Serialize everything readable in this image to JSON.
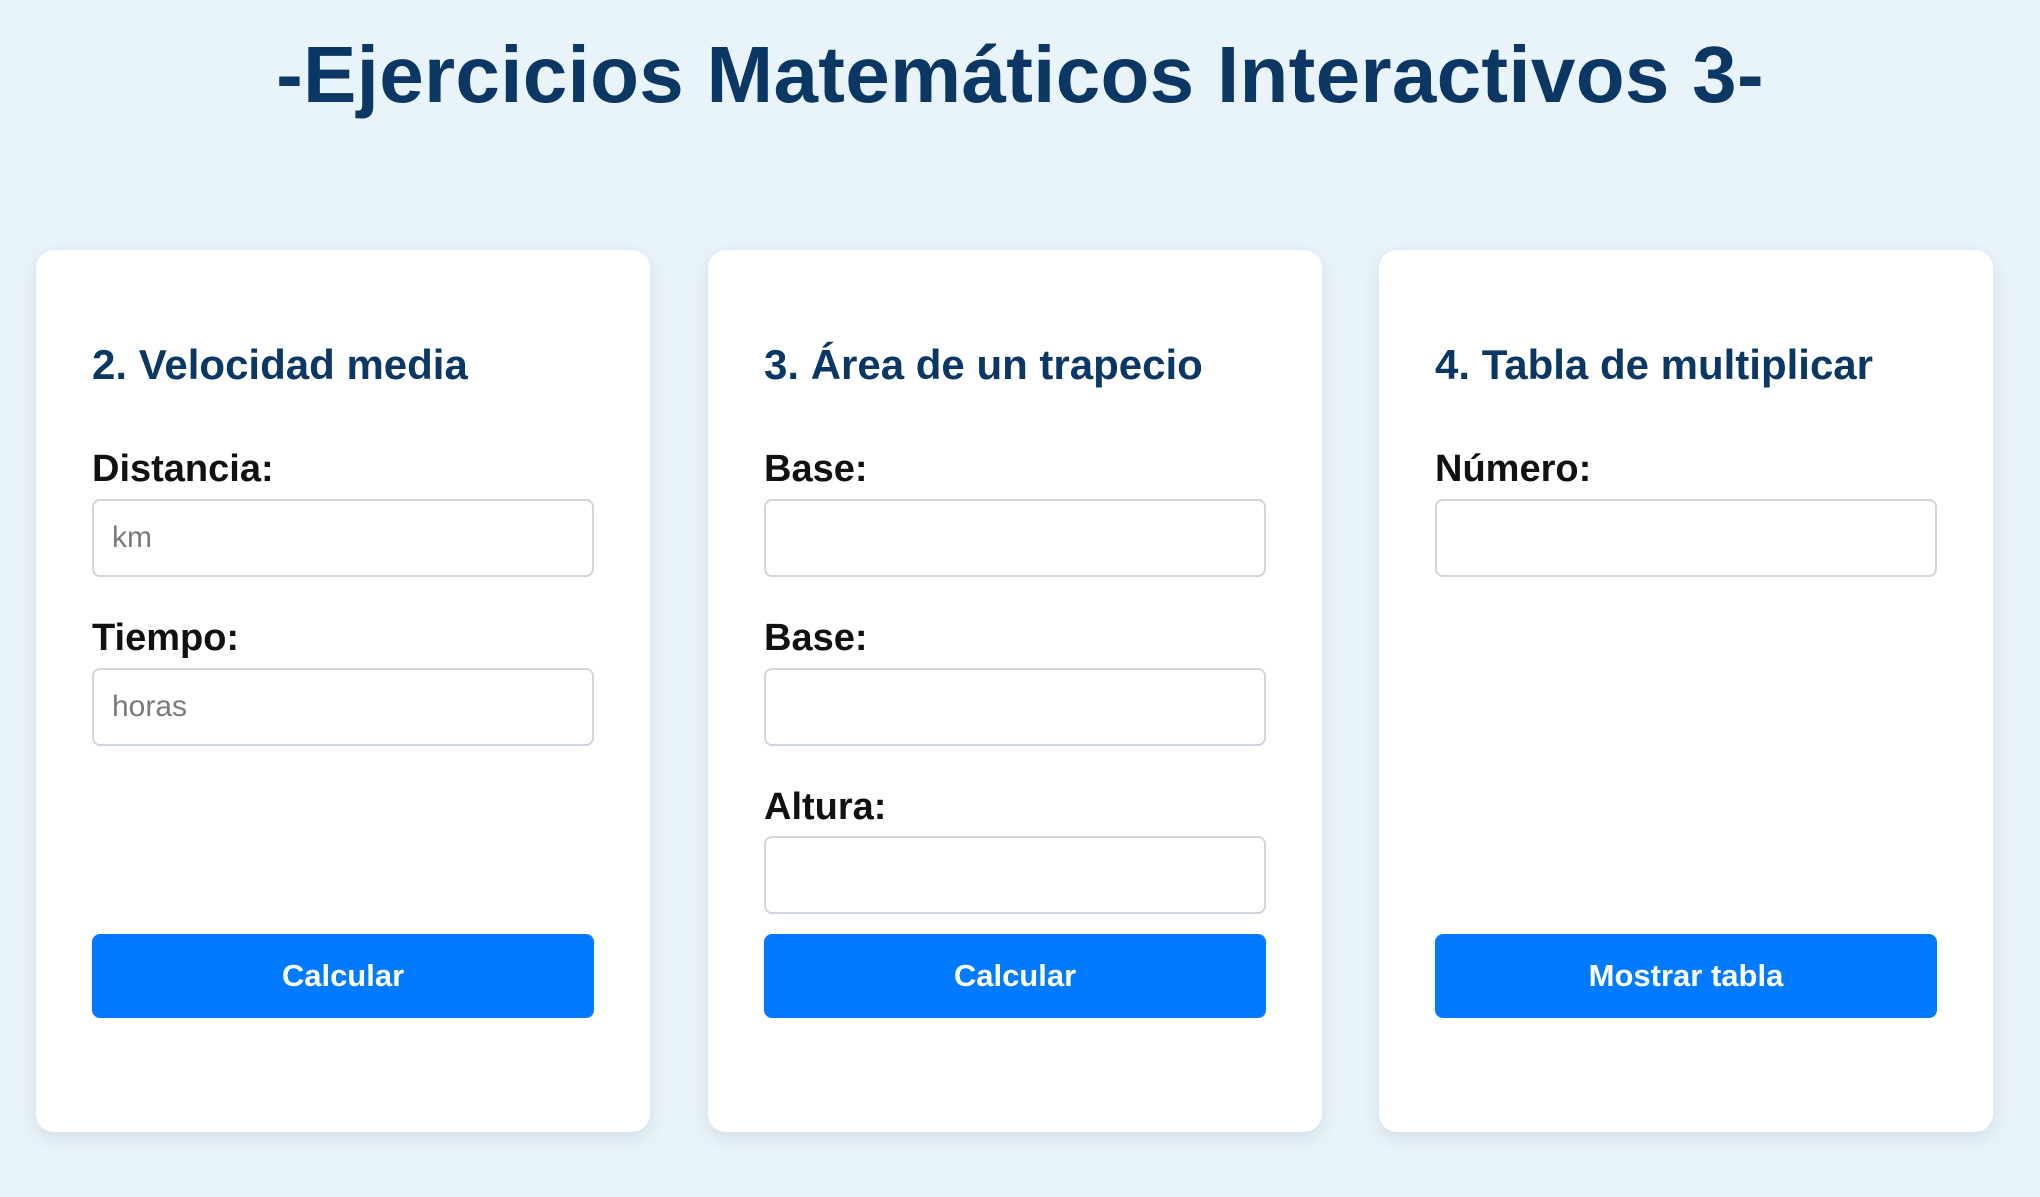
{
  "page": {
    "title": "-Ejercicios Matemáticos Interactivos 3-"
  },
  "cards": [
    {
      "title": "2. Velocidad media",
      "fields": [
        {
          "label": "Distancia:",
          "value": "",
          "placeholder": "km"
        },
        {
          "label": "Tiempo:",
          "value": "",
          "placeholder": "horas"
        }
      ],
      "button_label": "Calcular"
    },
    {
      "title": "3. Área de un trapecio",
      "fields": [
        {
          "label": "Base:",
          "value": "",
          "placeholder": ""
        },
        {
          "label": "Base:",
          "value": "",
          "placeholder": ""
        },
        {
          "label": "Altura:",
          "value": "",
          "placeholder": ""
        }
      ],
      "button_label": "Calcular"
    },
    {
      "title": "4. Tabla de multiplicar",
      "fields": [
        {
          "label": "Número:",
          "value": "",
          "placeholder": ""
        }
      ],
      "button_label": "Mostrar tabla"
    }
  ],
  "colors": {
    "background": "#e9f3fa",
    "heading": "#0b3764",
    "button": "#007bff",
    "button_text": "#ffffff",
    "card": "#ffffff"
  }
}
